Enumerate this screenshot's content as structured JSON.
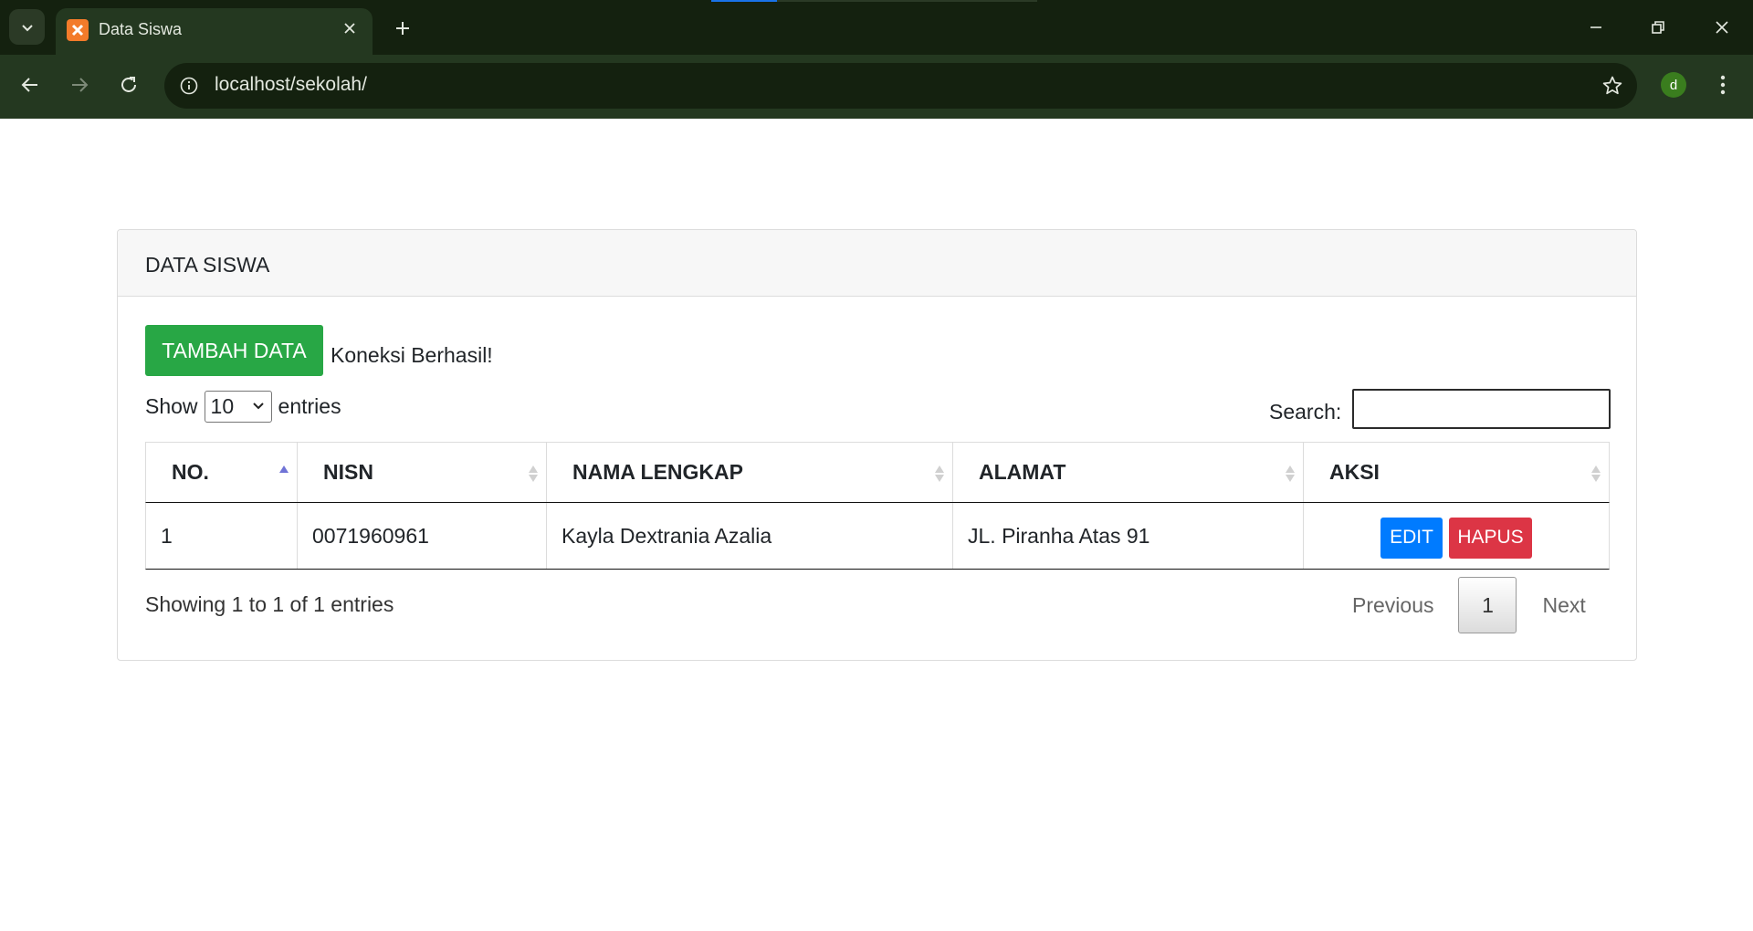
{
  "browser": {
    "tab_title": "Data Siswa",
    "url": "localhost/sekolah/",
    "profile_initial": "d"
  },
  "colors": {
    "success": "#28a745",
    "primary": "#007bff",
    "danger": "#dc3545"
  },
  "card": {
    "title": "DATA SISWA",
    "add_button": "TAMBAH DATA",
    "status_message": "Koneksi Berhasil!"
  },
  "datatable": {
    "show_label": "Show",
    "page_length": "10",
    "entries_label": "entries",
    "search_label": "Search:",
    "search_value": "",
    "columns": [
      "NO.",
      "NISN",
      "NAMA LENGKAP",
      "ALAMAT",
      "AKSI"
    ],
    "rows": [
      {
        "no": "1",
        "nisn": "0071960961",
        "nama": "Kayla Dextrania Azalia",
        "alamat": "JL. Piranha Atas 91",
        "edit": "EDIT",
        "hapus": "HAPUS"
      }
    ],
    "info": "Showing 1 to 1 of 1 entries",
    "pagination": {
      "previous": "Previous",
      "current": "1",
      "next": "Next"
    }
  }
}
